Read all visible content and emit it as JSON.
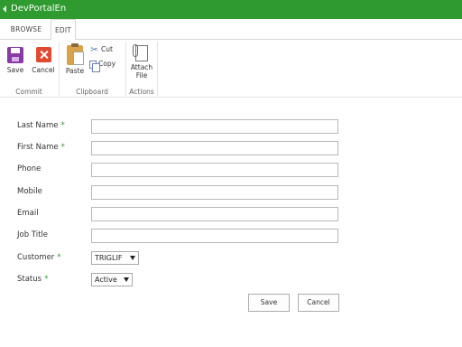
{
  "suitebar": {
    "title": "DevPortalEn"
  },
  "tabs": {
    "browse": "BROWSE",
    "edit": "EDIT"
  },
  "ribbon": {
    "commit": {
      "label": "Commit",
      "save": "Save",
      "cancel": "Cancel"
    },
    "clipboard": {
      "label": "Clipboard",
      "paste": "Paste",
      "cut": "Cut",
      "copy": "Copy"
    },
    "actions": {
      "label": "Actions",
      "attach_line1": "Attach",
      "attach_line2": "File"
    }
  },
  "form": {
    "fields": [
      {
        "label": "Last Name",
        "required": "*",
        "value": ""
      },
      {
        "label": "First Name",
        "required": "*",
        "value": ""
      },
      {
        "label": "Phone",
        "value": ""
      },
      {
        "label": "Mobile",
        "value": ""
      },
      {
        "label": "Email",
        "value": ""
      },
      {
        "label": "Job Title",
        "value": ""
      }
    ],
    "customer": {
      "label": "Customer",
      "required": "*",
      "selected": "TRIGLIF"
    },
    "status": {
      "label": "Status",
      "required": "*",
      "selected": "Active"
    },
    "save_label": "Save",
    "cancel_label": "Cancel"
  }
}
